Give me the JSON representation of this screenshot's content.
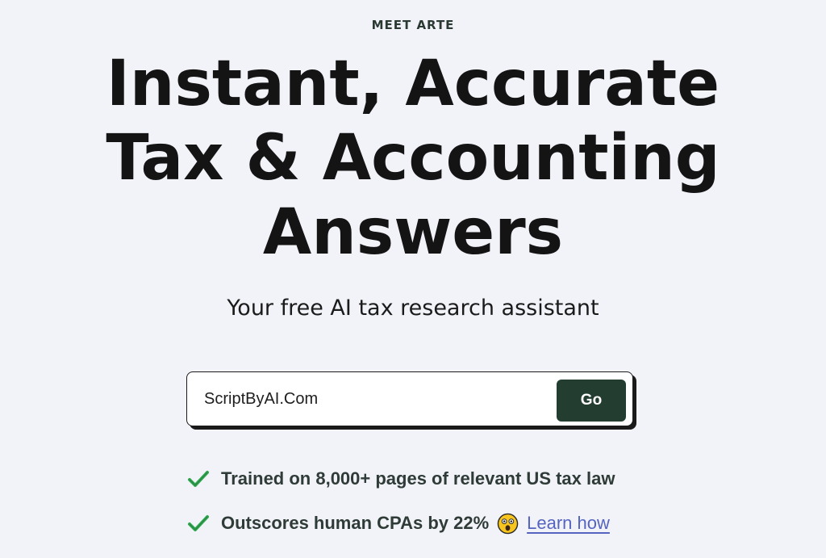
{
  "hero": {
    "eyebrow": "MEET ARTE",
    "headline_line1": "Instant, Accurate",
    "headline_line2": "Tax & Accounting",
    "headline_line3": "Answers",
    "subtitle": "Your free AI tax research assistant"
  },
  "search": {
    "value": "ScriptByAI.Com",
    "placeholder": "",
    "button_label": "Go"
  },
  "features": [
    {
      "text": "Trained on 8,000+ pages of relevant US tax law",
      "icon": "check-icon"
    },
    {
      "text": "Outscores human CPAs by 22%",
      "icon": "check-icon",
      "emoji_icon": "astonished-face-icon",
      "link_label": "Learn how"
    }
  ],
  "colors": {
    "background": "#f2f3f9",
    "button_bg": "#233e30",
    "check": "#2fa84f",
    "link": "#5564c0"
  }
}
